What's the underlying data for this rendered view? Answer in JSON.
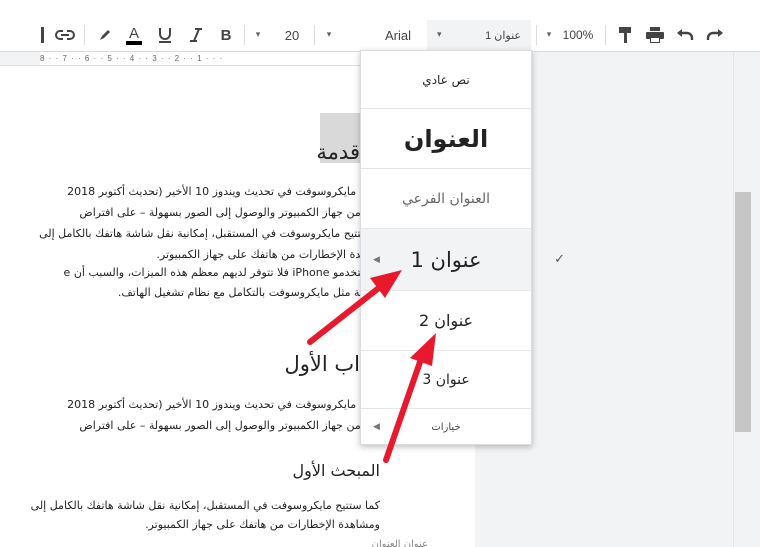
{
  "toolbar": {
    "font_size": "20",
    "font_name": "Arial",
    "style_value": "عنوان 1",
    "zoom": "100%",
    "bold_label": "B"
  },
  "ruler": {
    "marks": "8 · · 7 · · 6 · · 5 · · 4 · · 3 · · 2 · · 1 · · ·"
  },
  "document": {
    "title_fragment": "قدمة",
    "para1": [
      "ت مايكروسوفت في تحديث ويندوز 10 الأخير (تحديث أكتوبر 2018",
      "ة من جهاز الكمبيوتر والوصول إلى الصور بسهولة – على افتراض",
      "ستتيح مايكروسوفت في المستقبل، إمكانية نقل شاشة هاتفك بالكامل إلى",
      "اهدة الإخطارات من هاتفك على جهاز الكمبيوتر.",
      "ستخدمو iPhone فلا تتوفر لديهم معظم هذه الميزات، والسبب أن e",
      "جية مثل مايكروسوفت بالتكامل مع نظام تشغيل الهاتف."
    ],
    "chapter_fragment": "اب الأول",
    "para2": [
      "ت مايكروسوفت في تحديث ويندوز 10 الأخير (تحديث أكتوبر 2018",
      "ة من جهاز الكمبيوتر والوصول إلى الصور بسهولة – على افتراض"
    ],
    "section_heading": "المبحث الأول",
    "para3": [
      "كما ستتيح مايكروسوفت في المستقبل، إمكانية نقل شاشة هاتفك بالكامل إلى",
      "ومشاهدة الإخطارات من هاتفك على جهاز الكمبيوتر."
    ],
    "bottom_fragment": "عنوان العنوان"
  },
  "menu": {
    "items": [
      {
        "label": "نص عادي"
      },
      {
        "label": "العنوان"
      },
      {
        "label": "العنوان الفرعي"
      },
      {
        "label": "عنوان 1",
        "selected": true
      },
      {
        "label": "عنوان 2"
      },
      {
        "label": "عنوان 3"
      },
      {
        "label": "خيارات"
      }
    ],
    "check_mark": "✓"
  },
  "colors": {
    "arrow": "#e8192c",
    "selected_bg": "#f1f3f4",
    "highlight": "#d9d9d9"
  }
}
